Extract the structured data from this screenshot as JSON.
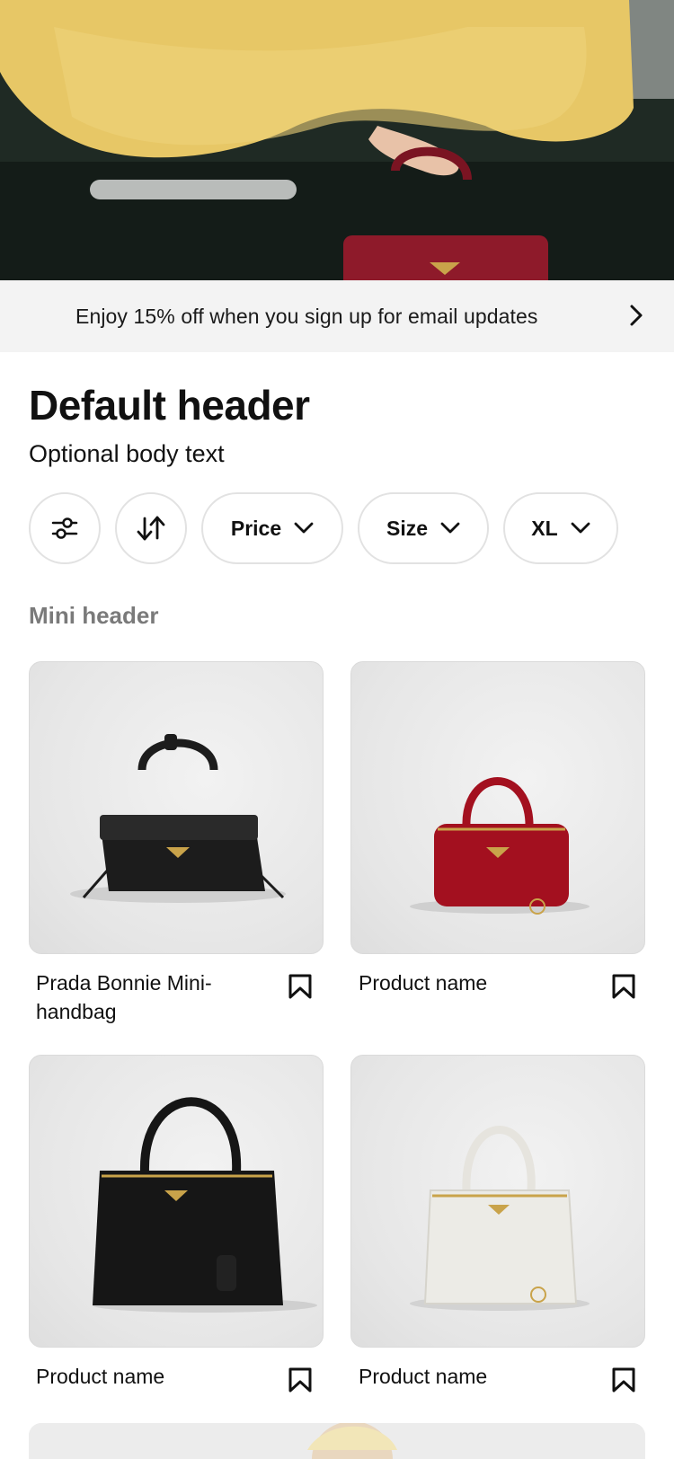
{
  "hero": {
    "image_alt": "Model in yellow knit sweater leaning on car holding red handbag",
    "colors": {
      "sweater": "#e8c86a",
      "bag": "#8e1a2a",
      "car": "#1e2a24"
    }
  },
  "promo": {
    "text": "Enjoy 15% off when you sign up for email updates",
    "icon": "chevron-right-icon"
  },
  "header": {
    "title": "Default header",
    "body": "Optional body text"
  },
  "filters": {
    "items": [
      {
        "type": "icon",
        "icon": "sliders-icon",
        "label": ""
      },
      {
        "type": "icon",
        "icon": "sort-icon",
        "label": ""
      },
      {
        "type": "dropdown",
        "label": "Price",
        "icon": "chevron-down-icon"
      },
      {
        "type": "dropdown",
        "label": "Size",
        "icon": "chevron-down-icon"
      },
      {
        "type": "dropdown",
        "label": "XL",
        "icon": "chevron-down-icon"
      }
    ]
  },
  "section": {
    "mini_header": "Mini header"
  },
  "products": [
    {
      "name": "Prada Bonnie Mini-handbag",
      "bag_color": "#1c1c1c",
      "icon": "bookmark-icon"
    },
    {
      "name": "Product name",
      "bag_color": "#a3101f",
      "icon": "bookmark-icon"
    },
    {
      "name": "Product name",
      "bag_color": "#161616",
      "icon": "bookmark-icon"
    },
    {
      "name": "Product name",
      "bag_color": "#ecebe6",
      "icon": "bookmark-icon"
    }
  ]
}
